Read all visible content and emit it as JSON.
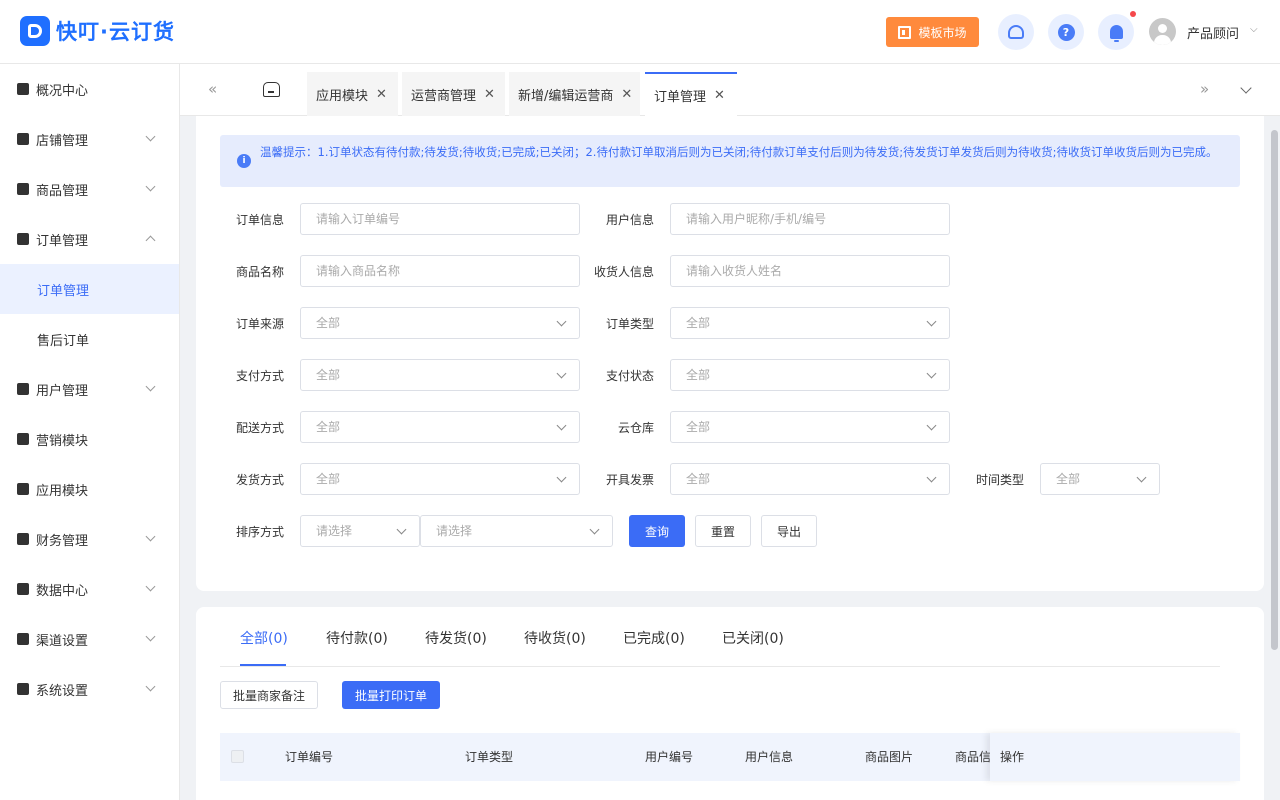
{
  "header": {
    "logo_text": "快叮·云订货",
    "market_label": "模板市场",
    "help_glyph": "?",
    "user_name": "产品顾问",
    "user_caret": "⌵"
  },
  "sidebar": {
    "items": [
      {
        "label": "概况中心",
        "icon": "dashboard-icon"
      },
      {
        "label": "店铺管理",
        "icon": "store-icon"
      },
      {
        "label": "商品管理",
        "icon": "goods-icon"
      },
      {
        "label": "订单管理",
        "icon": "order-icon"
      },
      {
        "label": "用户管理",
        "icon": "user-icon"
      },
      {
        "label": "营销模块",
        "icon": "marketing-icon"
      },
      {
        "label": "应用模块",
        "icon": "apps-icon"
      },
      {
        "label": "财务管理",
        "icon": "wallet-icon"
      },
      {
        "label": "数据中心",
        "icon": "chart-icon"
      },
      {
        "label": "渠道设置",
        "icon": "channel-icon"
      },
      {
        "label": "系统设置",
        "icon": "gear-icon"
      }
    ],
    "sub_items": [
      {
        "label": "订单管理"
      },
      {
        "label": "售后订单"
      }
    ]
  },
  "tabbar": {
    "left_arrow": "«",
    "right_arrow": "»",
    "close_glyph": "✕",
    "tabs": [
      {
        "label": "应用模块"
      },
      {
        "label": "运营商管理"
      },
      {
        "label": "新增/编辑运营商"
      },
      {
        "label": "订单管理"
      }
    ]
  },
  "tip": {
    "icon_glyph": "i",
    "text": "温馨提示：1.订单状态有待付款;待发货;待收货;已完成;已关闭；2.待付款订单取消后则为已关闭;待付款订单支付后则为待发货;待发货订单发货后则为待收货;待收货订单收货后则为已完成。"
  },
  "filters": {
    "order_info": {
      "label": "订单信息",
      "placeholder": "请输入订单编号"
    },
    "user_info": {
      "label": "用户信息",
      "placeholder": "请输入用户昵称/手机/编号"
    },
    "product_name": {
      "label": "商品名称",
      "placeholder": "请输入商品名称"
    },
    "receiver_info": {
      "label": "收货人信息",
      "placeholder": "请输入收货人姓名"
    },
    "order_source": {
      "label": "订单来源",
      "value": "全部"
    },
    "order_type": {
      "label": "订单类型",
      "value": "全部"
    },
    "pay_method": {
      "label": "支付方式",
      "value": "全部"
    },
    "pay_status": {
      "label": "支付状态",
      "value": "全部"
    },
    "delivery_method": {
      "label": "配送方式",
      "value": "全部"
    },
    "cloud_warehouse": {
      "label": "云仓库",
      "value": "全部"
    },
    "ship_method": {
      "label": "发货方式",
      "value": "全部"
    },
    "invoice": {
      "label": "开具发票",
      "value": "全部"
    },
    "time_type": {
      "label": "时间类型",
      "value": "全部"
    },
    "sort": {
      "label": "排序方式",
      "value1": "请选择",
      "value2": "请选择"
    }
  },
  "actions": {
    "query": "查询",
    "reset": "重置",
    "export": "导出"
  },
  "status_tabs": [
    {
      "label": "全部(0)"
    },
    {
      "label": "待付款(0)"
    },
    {
      "label": "待发货(0)"
    },
    {
      "label": "待收货(0)"
    },
    {
      "label": "已完成(0)"
    },
    {
      "label": "已关闭(0)"
    }
  ],
  "batch": {
    "remark": "批量商家备注",
    "print": "批量打印订单"
  },
  "table": {
    "columns": [
      "订单编号",
      "订单类型",
      "用户编号",
      "用户信息",
      "商品图片",
      "商品信息",
      "操作"
    ]
  },
  "colors": {
    "primary": "#3b6cf6",
    "orange": "#ff8a3c",
    "tip_bg": "#e6ecfd",
    "active_bg": "#ebf1ff",
    "badge_red": "#f5484b"
  }
}
